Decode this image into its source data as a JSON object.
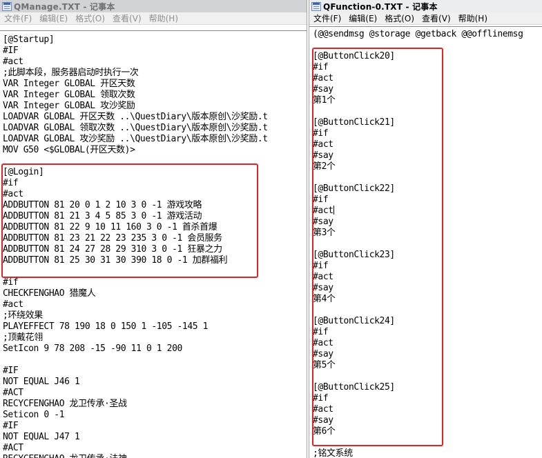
{
  "left_window": {
    "title": "QManage.TXT - 记事本",
    "menu": [
      "文件(F)",
      "编辑(E)",
      "格式(O)",
      "查看(V)",
      "帮助(H)"
    ],
    "lines": [
      "[@Startup]",
      "#IF",
      "#act",
      ";此脚本段，服务器启动时执行一次",
      "VAR Integer GLOBAL 开区天数",
      "VAR Integer GLOBAL 领取次数",
      "VAR Integer GLOBAL 攻沙奖励",
      "LOADVAR GLOBAL 开区天数 ..\\QuestDiary\\版本原创\\沙奖励.t",
      "LOADVAR GLOBAL 领取次数 ..\\QuestDiary\\版本原创\\沙奖励.t",
      "LOADVAR GLOBAL 攻沙奖励 ..\\QuestDiary\\版本原创\\沙奖励.t",
      "MOV G50 <$GLOBAL(开区天数)>",
      "",
      "[@Login]",
      "#if",
      "#act",
      "ADDBUTTON 81 20 0 1 2 10 3 0 -1 游戏攻略",
      "ADDBUTTON 81 21 3 4 5 85 3 0 -1 游戏活动",
      "ADDBUTTON 81 22 9 10 11 160 3 0 -1 首杀首爆",
      "ADDBUTTON 81 23 21 22 23 235 3 0 -1 会员服务",
      "ADDBUTTON 81 24 27 28 29 310 3 0 -1 狂暴之力",
      "ADDBUTTON 81 25 30 31 30 390 18 0 -1 加群福利",
      "",
      "#if",
      "CHECKFENGHAO 猎魔人",
      "#act",
      ";环绕效果",
      "PLAYEFFECT 78 190 18 0 150 1 -105 -145 1",
      ";顶戴花翎",
      "SetIcon 9 78 208 -15 -90 11 0 1 200",
      "",
      "#IF",
      "NOT EQUAL J46 1",
      "#ACT",
      "RECYCFENGHAO 龙卫传承·圣战",
      "Seticon 0 -1",
      "#IF",
      "NOT EQUAL J47 1",
      "#ACT",
      "RECYCFENGHAO 龙卫传承·法神"
    ]
  },
  "right_window": {
    "title": "QFunction-0.TXT - 记事本",
    "menu": [
      "文件(F)",
      "编辑(E)",
      "格式(O)",
      "查看(V)",
      "帮助(H)"
    ],
    "lines": [
      "(@@sendmsg @storage @getback @@offlinemsg",
      "",
      "[@ButtonClick20]",
      "#if",
      "#act",
      "#say",
      "第1个",
      "",
      "[@ButtonClick21]",
      "#if",
      "#act",
      "#say",
      "第2个",
      "",
      "[@ButtonClick22]",
      "#if",
      "#act",
      "#say",
      "第3个",
      "",
      "[@ButtonClick23]",
      "#if",
      "#act",
      "#say",
      "第4个",
      "",
      "[@ButtonClick24]",
      "#if",
      "#act",
      "#say",
      "第5个",
      "",
      "[@ButtonClick25]",
      "#if",
      "#act",
      "#say",
      "第6个",
      "",
      ";铭文系统"
    ]
  },
  "colors": {
    "highlight": "#e8201f"
  },
  "icons": {
    "app": "notepad-icon"
  }
}
